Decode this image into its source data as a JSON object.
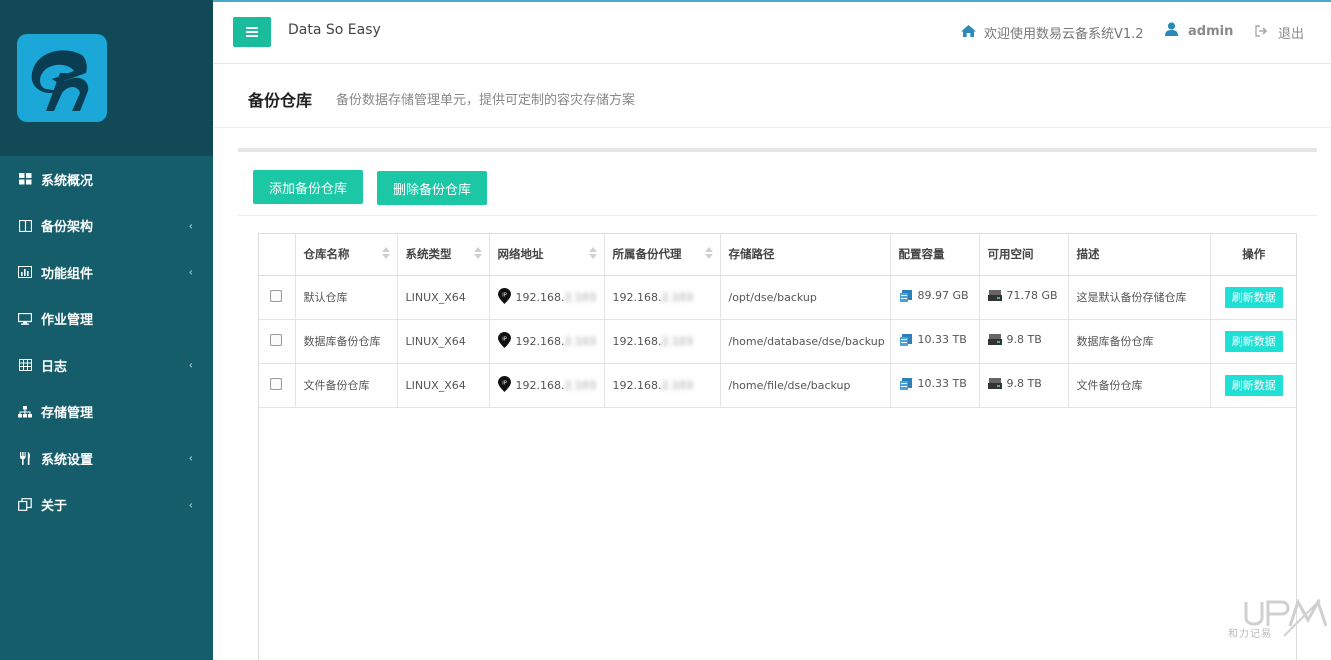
{
  "app": {
    "brand": "Data So Easy"
  },
  "topbar": {
    "welcome": "欢迎使用数易云备系统V1.2",
    "user": "admin",
    "logout": "退出",
    "accent": "#1abc9c"
  },
  "sidebar": {
    "items": [
      {
        "label": "系统概况",
        "icon": "grid-icon",
        "has_submenu": false
      },
      {
        "label": "备份架构",
        "icon": "columns-icon",
        "has_submenu": true
      },
      {
        "label": "功能组件",
        "icon": "bar-chart-icon",
        "has_submenu": true
      },
      {
        "label": "作业管理",
        "icon": "monitor-icon",
        "has_submenu": false
      },
      {
        "label": "日志",
        "icon": "table-icon",
        "has_submenu": true
      },
      {
        "label": "存储管理",
        "icon": "sitemap-icon",
        "has_submenu": false
      },
      {
        "label": "系统设置",
        "icon": "utensils-icon",
        "has_submenu": true
      },
      {
        "label": "关于",
        "icon": "copy-icon",
        "has_submenu": true
      }
    ],
    "bg": "#155d6b"
  },
  "page": {
    "title": "备份仓库",
    "subtitle": "备份数据存储管理单元，提供可定制的容灾存储方案"
  },
  "actions": {
    "add": "添加备份仓库",
    "delete": "删除备份仓库"
  },
  "table": {
    "headers": [
      "仓库名称",
      "系统类型",
      "网络地址",
      "所属备份代理",
      "存储路径",
      "配置容量",
      "可用空间",
      "描述",
      "操作"
    ],
    "rows": [
      {
        "name": "默认仓库",
        "os": "LINUX_X64",
        "ip": "192.168.",
        "ip_masked": "2.103",
        "proxy": "192.168.",
        "proxy_masked": "2.103",
        "path": "/opt/dse/backup",
        "capacity": "89.97 GB",
        "free": "71.78 GB",
        "desc": "这是默认备份存储仓库",
        "op": "刷新数据"
      },
      {
        "name": "数据库备份仓库",
        "os": "LINUX_X64",
        "ip": "192.168.",
        "ip_masked": "2.103",
        "proxy": "192.168.",
        "proxy_masked": "2.103",
        "path": "/home/database/dse/backup",
        "capacity": "10.33 TB",
        "free": "9.8 TB",
        "desc": "数据库备份仓库",
        "op": "刷新数据"
      },
      {
        "name": "文件备份仓库",
        "os": "LINUX_X64",
        "ip": "192.168.",
        "ip_masked": "2.103",
        "proxy": "192.168.",
        "proxy_masked": "2.103",
        "path": "/home/file/dse/backup",
        "capacity": "10.33 TB",
        "free": "9.8 TB",
        "desc": "文件备份仓库",
        "op": "刷新数据"
      }
    ]
  },
  "watermark": {
    "text": "和力记易"
  }
}
